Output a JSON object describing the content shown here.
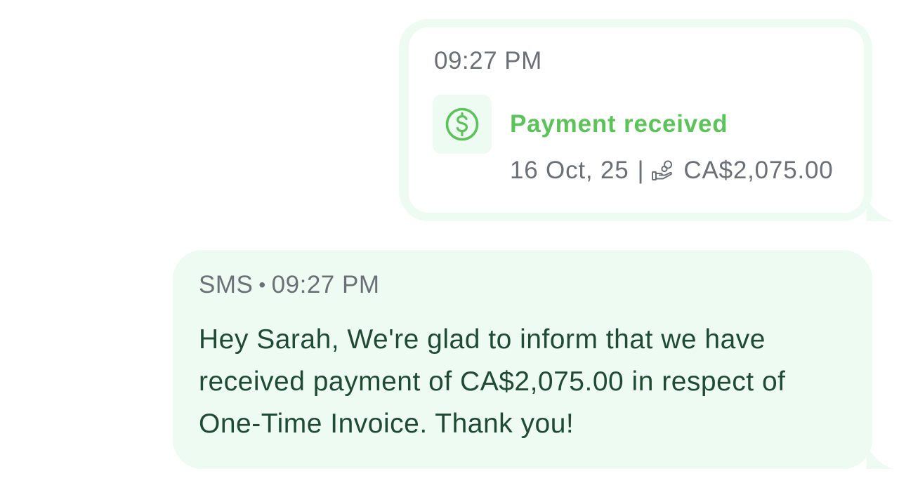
{
  "event_card": {
    "time": "09:27 PM",
    "icon": "dollar-circle-icon",
    "title": "Payment received",
    "date": "16 Oct, 25",
    "separator": "|",
    "amount_icon": "hand-coins-icon",
    "amount": "CA$2,075.00"
  },
  "sms_message": {
    "channel": "SMS",
    "dot": "•",
    "time": "09:27 PM",
    "body": "Hey Sarah, We're glad to inform that we have received payment of CA$2,075.00 in respect of One-Time Invoice. Thank you!"
  },
  "colors": {
    "bubble_background": "#eefbf3",
    "accent_green": "#5cc35a",
    "meta_gray": "#6b6f76",
    "body_text": "#1f4b35"
  }
}
